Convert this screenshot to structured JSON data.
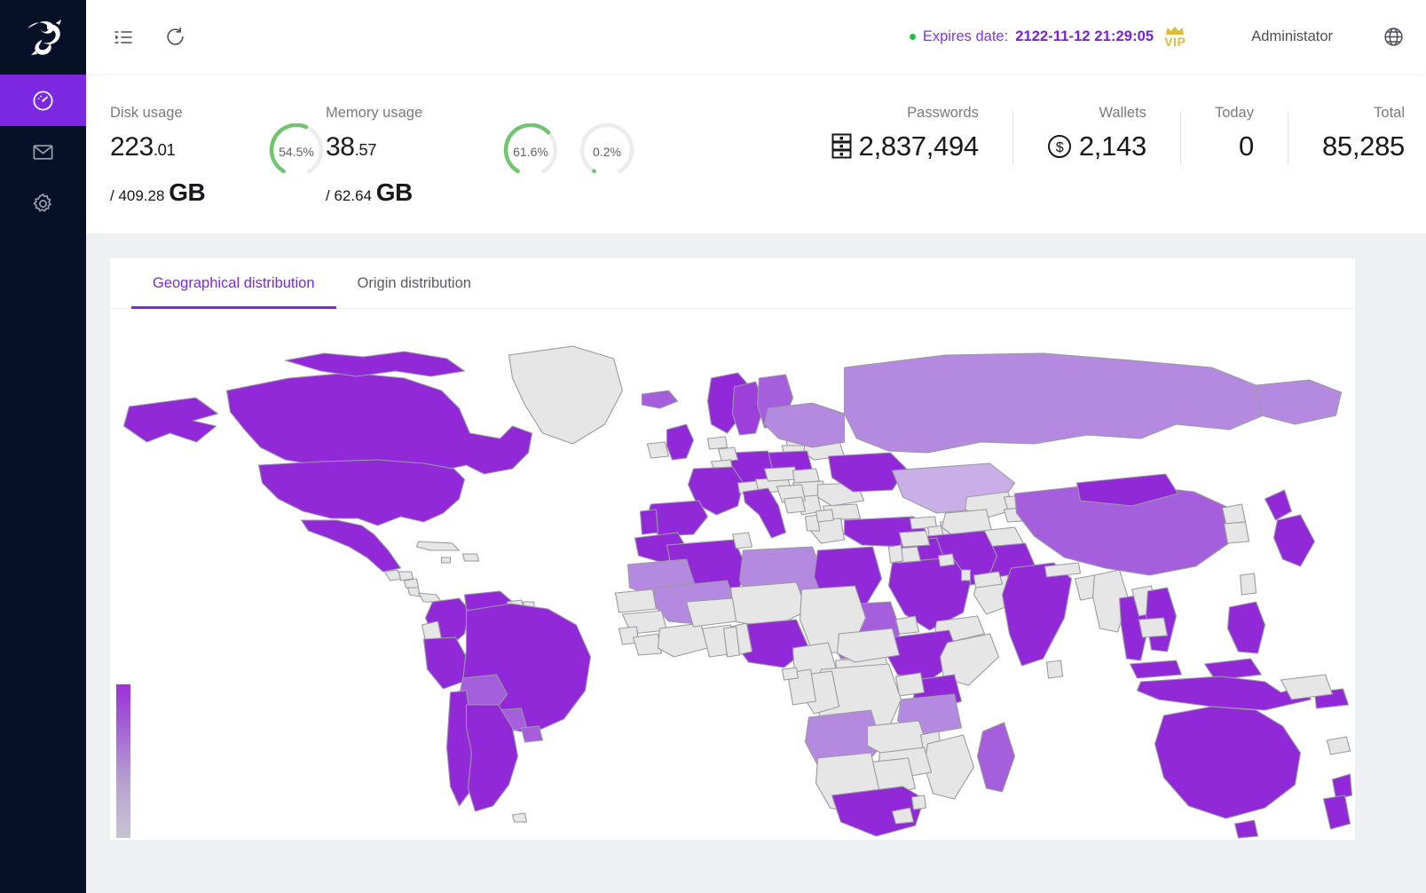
{
  "sidebar": {
    "logo_icon": "dragon-logo-icon",
    "items": [
      {
        "icon": "dashboard-gauge-icon",
        "name": "dashboard",
        "active": true
      },
      {
        "icon": "mail-envelope-icon",
        "name": "messages",
        "active": false
      },
      {
        "icon": "gear-settings-icon",
        "name": "settings",
        "active": false
      }
    ]
  },
  "header": {
    "menu_toggle_icon": "menu-indent-icon",
    "refresh_icon": "refresh-icon",
    "status_dot_color": "#26c03f",
    "expires_label": "Expires date:",
    "expires_value": "2122-11-12 21:29:05",
    "vip_badge": "VIP",
    "vip_icon": "crown-icon",
    "vip_color": "#e0bb3a",
    "user_name": "Administator",
    "language_icon": "globe-icon",
    "accent_color": "#7c28e0"
  },
  "stats": {
    "disk": {
      "title": "Disk usage",
      "used_int": "223",
      "used_dec": ".01",
      "total": "/ 409.28",
      "unit": "GB"
    },
    "memory": {
      "title": "Memory usage",
      "used_int": "38",
      "used_dec": ".57",
      "total": "/ 62.64",
      "unit": "GB"
    },
    "gauges": [
      {
        "name": "disk-gauge",
        "value": 54.5,
        "label": "54.5%",
        "color": "#72c472"
      },
      {
        "name": "memory-gauge",
        "value": 61.6,
        "label": "61.6%",
        "color": "#72c472"
      },
      {
        "name": "cpu-gauge",
        "value": 0.2,
        "label": "0.2%",
        "color": "#72c472"
      }
    ],
    "kpis": [
      {
        "name": "passwords",
        "label": "Passwords",
        "value": "2,837,494",
        "icon": "server-stack-icon"
      },
      {
        "name": "wallets",
        "label": "Wallets",
        "value": "2,143",
        "icon": "dollar-circle-icon"
      },
      {
        "name": "today",
        "label": "Today",
        "value": "0",
        "icon": ""
      },
      {
        "name": "total",
        "label": "Total",
        "value": "85,285",
        "icon": ""
      }
    ]
  },
  "main": {
    "tabs": [
      {
        "name": "geographical-distribution",
        "label": "Geographical distribution",
        "active": true
      },
      {
        "name": "origin-distribution",
        "label": "Origin distribution",
        "active": false
      }
    ]
  },
  "chart_data": {
    "type": "map",
    "title": "Geographical distribution",
    "projection": "equirectangular-world",
    "legend": {
      "position": "bottom-left",
      "orientation": "vertical",
      "gradient_from": "#9b30d9",
      "gradient_to": "#c6c3d4",
      "labels": []
    },
    "no_data_color": "#e6e6e6",
    "ocean_color": "#ffffff",
    "border_color": "#9a9aa0",
    "color_scale": [
      "#c7c4d6",
      "#c9aee8",
      "#b489e0",
      "#a55fdd",
      "#9c3fdb",
      "#9229d8"
    ],
    "regions": [
      {
        "code": "US",
        "name": "United States",
        "level": 5
      },
      {
        "code": "CA",
        "name": "Canada",
        "level": 5
      },
      {
        "code": "MX",
        "name": "Mexico",
        "level": 5
      },
      {
        "code": "BR",
        "name": "Brazil",
        "level": 5
      },
      {
        "code": "AR",
        "name": "Argentina",
        "level": 5
      },
      {
        "code": "CL",
        "name": "Chile",
        "level": 5
      },
      {
        "code": "CO",
        "name": "Colombia",
        "level": 5
      },
      {
        "code": "PE",
        "name": "Peru",
        "level": 5
      },
      {
        "code": "VE",
        "name": "Venezuela",
        "level": 5
      },
      {
        "code": "BO",
        "name": "Bolivia",
        "level": 3
      },
      {
        "code": "PY",
        "name": "Paraguay",
        "level": 3
      },
      {
        "code": "UY",
        "name": "Uruguay",
        "level": 3
      },
      {
        "code": "GY",
        "name": "Guyana",
        "level": 0
      },
      {
        "code": "GL",
        "name": "Greenland",
        "level": 0
      },
      {
        "code": "GB",
        "name": "United Kingdom",
        "level": 5
      },
      {
        "code": "FR",
        "name": "France",
        "level": 5
      },
      {
        "code": "DE",
        "name": "Germany",
        "level": 5
      },
      {
        "code": "ES",
        "name": "Spain",
        "level": 5
      },
      {
        "code": "PT",
        "name": "Portugal",
        "level": 5
      },
      {
        "code": "IT",
        "name": "Italy",
        "level": 5
      },
      {
        "code": "PL",
        "name": "Poland",
        "level": 5
      },
      {
        "code": "UA",
        "name": "Ukraine",
        "level": 5
      },
      {
        "code": "NO",
        "name": "Norway",
        "level": 5
      },
      {
        "code": "SE",
        "name": "Sweden",
        "level": 4
      },
      {
        "code": "FI",
        "name": "Finland",
        "level": 3
      },
      {
        "code": "IS",
        "name": "Iceland",
        "level": 3
      },
      {
        "code": "TR",
        "name": "Turkey",
        "level": 5
      },
      {
        "code": "RU",
        "name": "Russia",
        "level": 2
      },
      {
        "code": "KZ",
        "name": "Kazakhstan",
        "level": 1
      },
      {
        "code": "CN",
        "name": "China",
        "level": 3
      },
      {
        "code": "MN",
        "name": "Mongolia",
        "level": 5
      },
      {
        "code": "JP",
        "name": "Japan",
        "level": 5
      },
      {
        "code": "KR",
        "name": "South Korea",
        "level": 0
      },
      {
        "code": "IN",
        "name": "India",
        "level": 5
      },
      {
        "code": "PK",
        "name": "Pakistan",
        "level": 5
      },
      {
        "code": "AF",
        "name": "Afghanistan",
        "level": 0
      },
      {
        "code": "IR",
        "name": "Iran",
        "level": 5
      },
      {
        "code": "IQ",
        "name": "Iraq",
        "level": 5
      },
      {
        "code": "SA",
        "name": "Saudi Arabia",
        "level": 5
      },
      {
        "code": "EG",
        "name": "Egypt",
        "level": 5
      },
      {
        "code": "DZ",
        "name": "Algeria",
        "level": 5
      },
      {
        "code": "MA",
        "name": "Morocco",
        "level": 5
      },
      {
        "code": "LY",
        "name": "Libya",
        "level": 2
      },
      {
        "code": "SD",
        "name": "Sudan",
        "level": 3
      },
      {
        "code": "NG",
        "name": "Nigeria",
        "level": 5
      },
      {
        "code": "ET",
        "name": "Ethiopia",
        "level": 5
      },
      {
        "code": "KE",
        "name": "Kenya",
        "level": 5
      },
      {
        "code": "ZA",
        "name": "South Africa",
        "level": 5
      },
      {
        "code": "TZ",
        "name": "Tanzania",
        "level": 2
      },
      {
        "code": "AO",
        "name": "Angola",
        "level": 2
      },
      {
        "code": "CD",
        "name": "DR Congo",
        "level": 0
      },
      {
        "code": "TD",
        "name": "Chad",
        "level": 0
      },
      {
        "code": "NE",
        "name": "Niger",
        "level": 0
      },
      {
        "code": "ML",
        "name": "Mali",
        "level": 2
      },
      {
        "code": "MR",
        "name": "Mauritania",
        "level": 2
      },
      {
        "code": "MG",
        "name": "Madagascar",
        "level": 3
      },
      {
        "code": "TH",
        "name": "Thailand",
        "level": 5
      },
      {
        "code": "VN",
        "name": "Vietnam",
        "level": 5
      },
      {
        "code": "MY",
        "name": "Malaysia",
        "level": 5
      },
      {
        "code": "ID",
        "name": "Indonesia",
        "level": 5
      },
      {
        "code": "PH",
        "name": "Philippines",
        "level": 5
      },
      {
        "code": "AU",
        "name": "Australia",
        "level": 5
      },
      {
        "code": "NZ",
        "name": "New Zealand",
        "level": 5
      },
      {
        "code": "PG",
        "name": "Papua New Guinea",
        "level": 0
      }
    ]
  }
}
